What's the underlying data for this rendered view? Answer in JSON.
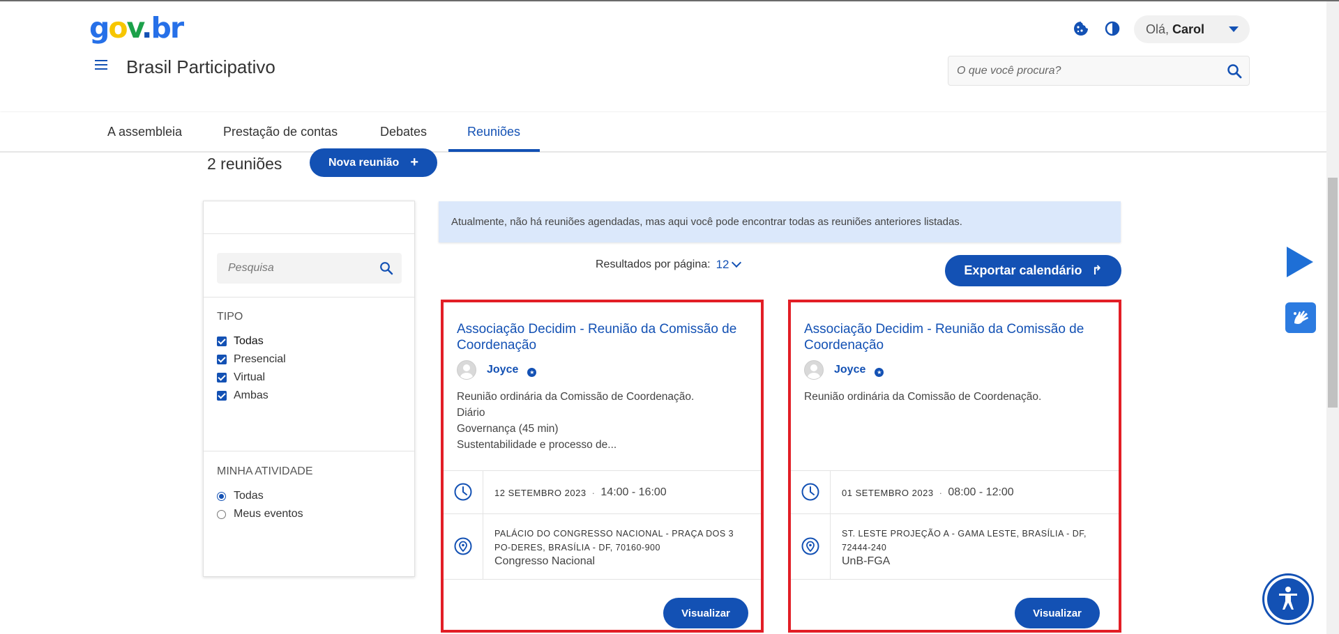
{
  "header": {
    "logo": {
      "g": "g",
      "o": "o",
      "v": "v",
      "dot": ".",
      "br": "br"
    },
    "site_title": "Brasil Participativo",
    "user_greeting": "Olá,",
    "user_name": "Carol",
    "search_placeholder": "O que você procura?",
    "icons": [
      "menu-icon",
      "cookie-icon",
      "contrast-icon",
      "caret-down-icon",
      "search-icon"
    ]
  },
  "tabs": [
    {
      "label": "A assembleia",
      "active": false
    },
    {
      "label": "Prestação de contas",
      "active": false
    },
    {
      "label": "Debates",
      "active": false
    },
    {
      "label": "Reuniões",
      "active": true
    }
  ],
  "summary": {
    "count_label": "2 reuniões",
    "new_meeting_label": "Nova reunião",
    "new_meeting_icon": "+"
  },
  "filters": {
    "search_placeholder": "Pesquisa",
    "type_heading": "TIPO",
    "type_options": [
      {
        "label": "Todas",
        "checked": true
      },
      {
        "label": "Presencial",
        "checked": true
      },
      {
        "label": "Virtual",
        "checked": true
      },
      {
        "label": "Ambas",
        "checked": true
      }
    ],
    "activity_heading": "MINHA ATIVIDADE",
    "activity_options": [
      {
        "label": "Todas",
        "selected": true
      },
      {
        "label": "Meus eventos",
        "selected": false
      }
    ]
  },
  "notice": "Atualmente, não há reuniões agendadas, mas aqui você pode encontrar todas as reuniões anteriores listadas.",
  "results": {
    "per_page_label": "Resultados por página:",
    "per_page_value": "12",
    "export_label": "Exportar calendário",
    "export_icon": "↱"
  },
  "meetings": [
    {
      "title": "Associação Decidim - Reunião da Comissão de Coordenação",
      "author": "Joyce",
      "description": [
        "Reunião ordinária da Comissão de Coordenação.",
        "Diário",
        "Governança (45 min)",
        "Sustentabilidade e processo de..."
      ],
      "date": "12 SETEMBRO 2023",
      "date_sep": "·",
      "time": "14:00 - 16:00",
      "address": "PALÁCIO DO CONGRESSO NACIONAL - PRAÇA DOS 3 PO-DERES, BRASÍLIA - DF, 70160-900",
      "place": "Congresso Nacional",
      "button": "Visualizar"
    },
    {
      "title": "Associação Decidim - Reunião da Comissão de Coordenação",
      "author": "Joyce",
      "description": [
        "Reunião ordinária da Comissão de Coordenação."
      ],
      "date": "01 SETEMBRO 2023",
      "date_sep": "·",
      "time": "08:00 - 12:00",
      "address": "ST. LESTE PROJEÇÃO A - GAMA LESTE, BRASÍLIA - DF, 72444-240",
      "place": "UnB-FGA",
      "button": "Visualizar"
    }
  ],
  "colors": {
    "primary": "#1351b4",
    "notice_bg": "#dbe8fb",
    "highlight_border": "#e21e26"
  }
}
